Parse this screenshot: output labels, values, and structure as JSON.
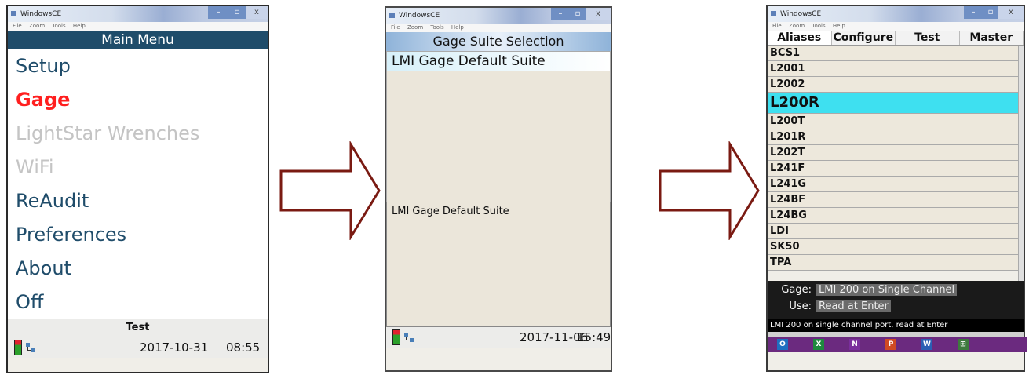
{
  "window_title": "WindowsCE",
  "menu_bar": [
    "File",
    "Zoom",
    "Tools",
    "Help"
  ],
  "screen1": {
    "header": "Main Menu",
    "items": [
      {
        "label": "Setup",
        "state": "normal"
      },
      {
        "label": "Gage",
        "state": "highlighted"
      },
      {
        "label": "LightStar Wrenches",
        "state": "disabled"
      },
      {
        "label": "WiFi",
        "state": "disabled"
      },
      {
        "label": "ReAudit",
        "state": "normal"
      },
      {
        "label": "Preferences",
        "state": "normal"
      },
      {
        "label": "About",
        "state": "normal"
      },
      {
        "label": "Off",
        "state": "normal"
      }
    ],
    "status": "Test",
    "date": "2017-10-31",
    "time": "08:55"
  },
  "screen2": {
    "header": "Gage Suite Selection",
    "selected": "LMI Gage Default Suite",
    "description": "LMI Gage Default Suite",
    "date": "2017-11-06",
    "time": "15:49"
  },
  "screen3": {
    "tabs": [
      "Aliases",
      "Configure",
      "Test",
      "Master"
    ],
    "rows": [
      "BCS1",
      "L2001",
      "L2002",
      "L200R",
      "L200T",
      "L201R",
      "L202T",
      "L241F",
      "L241G",
      "L24BF",
      "L24BG",
      "LDI",
      "SK50",
      "TPA"
    ],
    "selected_row": "L200R",
    "gage_label": "Gage:",
    "gage_value": "LMI 200 on Single Channel",
    "use_label": "Use:",
    "use_value": "Read at Enter",
    "footer": "LMI 200 on single channel port, read at Enter"
  },
  "colors": {
    "header_blue": "#1f4c6a",
    "highlight_red": "#ff1f1f",
    "selected_cyan": "#3ee0f0",
    "arrow": "#7a1a12"
  }
}
